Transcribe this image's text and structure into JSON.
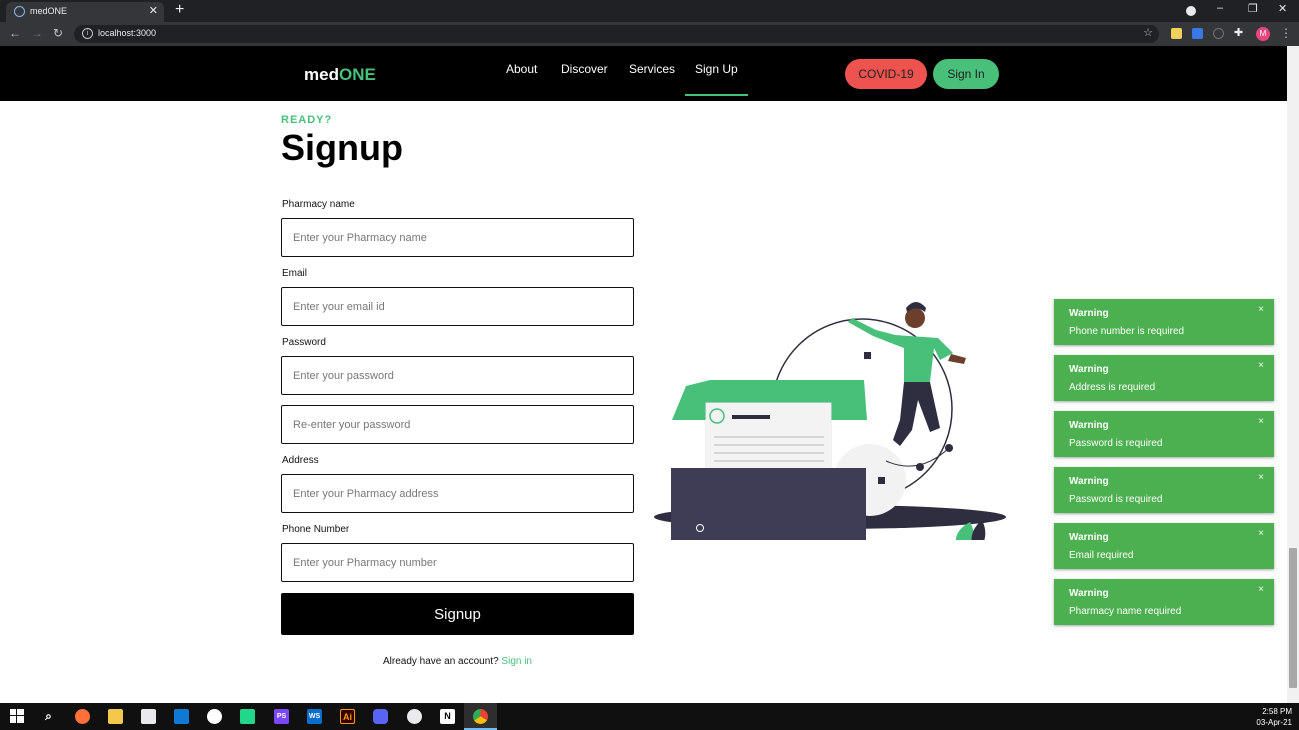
{
  "browser": {
    "tab_title": "medONE",
    "tab_close": "✕",
    "new_tab": "+",
    "url": "localhost:3000",
    "win_minimize": "–",
    "win_restore": "❐",
    "win_close": "✕",
    "profile_initial": "M"
  },
  "nav": {
    "brand_prefix": "med",
    "brand_suffix": "ONE",
    "links": [
      "About",
      "Discover",
      "Services",
      "Sign Up"
    ],
    "active_link": "Sign Up",
    "covid_button": "COVID-19",
    "signin_button": "Sign In"
  },
  "page": {
    "eyebrow": "READY?",
    "heading": "Signup"
  },
  "form": {
    "pharmacy_label": "Pharmacy name",
    "pharmacy_placeholder": "Enter your Pharmacy name",
    "email_label": "Email",
    "email_placeholder": "Enter your email id",
    "password_label": "Password",
    "password_placeholder": "Enter your password",
    "confirm_placeholder": "Re-enter your password",
    "address_label": "Address",
    "address_placeholder": "Enter your Pharmacy address",
    "phone_label": "Phone Number",
    "phone_placeholder": "Enter your Pharmacy number",
    "submit_label": "Signup",
    "already_text": "Already have an account?",
    "signin_link": "Sign in"
  },
  "toasts": [
    {
      "title": "Warning",
      "message": "Phone number is required",
      "close": "×"
    },
    {
      "title": "Warning",
      "message": "Address is required",
      "close": "×"
    },
    {
      "title": "Warning",
      "message": "Password is required",
      "close": "×"
    },
    {
      "title": "Warning",
      "message": "Password is required",
      "close": "×"
    },
    {
      "title": "Warning",
      "message": "Email required",
      "close": "×"
    },
    {
      "title": "Warning",
      "message": "Pharmacy name required",
      "close": "×"
    }
  ],
  "taskbar": {
    "time": "2:58 PM",
    "date": "03-Apr-21",
    "apps": [
      "start",
      "search",
      "firefox",
      "file-explorer",
      "store",
      "vscode",
      "app-w",
      "pycharm",
      "phpstorm",
      "webstorm",
      "illustrator",
      "discord",
      "app-x",
      "notion",
      "chrome"
    ],
    "illustrator_label": "Ai",
    "notion_label": "N",
    "webstorm_label": "WS",
    "phpstorm_label": "PS"
  },
  "colors": {
    "accent": "#48c07a",
    "covid": "#ef5350",
    "toast": "#4caf50",
    "nav_bg": "#000000"
  }
}
